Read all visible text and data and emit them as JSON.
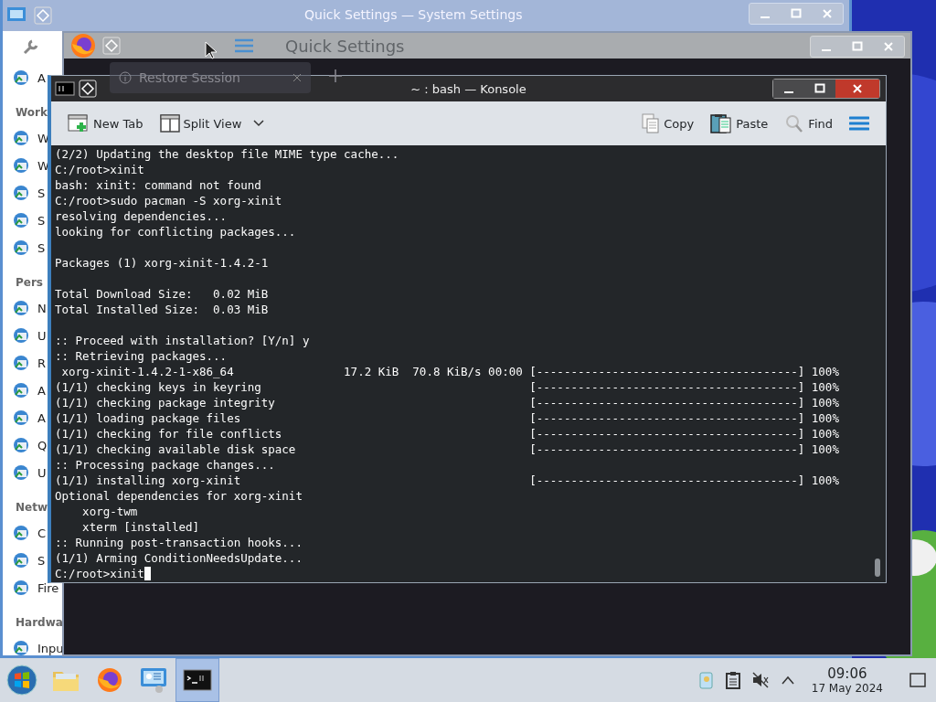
{
  "settings_window": {
    "title": "Quick Settings — System Settings",
    "sidebar": [
      {
        "kind": "item",
        "label": "A"
      },
      {
        "kind": "header",
        "label": "Work"
      },
      {
        "kind": "item",
        "label": "W"
      },
      {
        "kind": "item",
        "label": "W"
      },
      {
        "kind": "item",
        "label": "S"
      },
      {
        "kind": "item",
        "label": "S"
      },
      {
        "kind": "item",
        "label": "S"
      },
      {
        "kind": "header",
        "label": "Pers"
      },
      {
        "kind": "item",
        "label": "N"
      },
      {
        "kind": "item",
        "label": "U"
      },
      {
        "kind": "item",
        "label": "R"
      },
      {
        "kind": "item",
        "label": "A"
      },
      {
        "kind": "item",
        "label": "A"
      },
      {
        "kind": "item",
        "label": "Q"
      },
      {
        "kind": "item",
        "label": "U"
      },
      {
        "kind": "header",
        "label": "Netw"
      },
      {
        "kind": "item",
        "label": "C"
      },
      {
        "kind": "item",
        "label": "S"
      },
      {
        "kind": "item",
        "label": "Fire"
      },
      {
        "kind": "header",
        "label": "Hardwa"
      },
      {
        "kind": "item",
        "label": "Inpu"
      }
    ]
  },
  "browser_window": {
    "heading": "Quick Settings",
    "tab": {
      "label": "Restore Session"
    }
  },
  "konsole": {
    "title": "~ : bash — Konsole",
    "toolbar_left": [
      {
        "kind": "new-tab",
        "label": "New Tab"
      },
      {
        "kind": "split",
        "label": "Split View"
      }
    ],
    "toolbar_right": [
      {
        "kind": "copy",
        "label": "Copy"
      },
      {
        "kind": "paste",
        "label": "Paste"
      },
      {
        "kind": "find",
        "label": "Find"
      },
      {
        "kind": "menu"
      }
    ],
    "lines": [
      {
        "text": "(2/2) Updating the desktop file MIME type cache..."
      },
      {
        "text": "C:/root>xinit"
      },
      {
        "text": "bash: xinit: command not found"
      },
      {
        "text": "C:/root>sudo pacman -S xorg-xinit"
      },
      {
        "text": "resolving dependencies..."
      },
      {
        "text": "looking for conflicting packages..."
      },
      {
        "kind": "blank"
      },
      {
        "text": "Packages (1) xorg-xinit-1.4.2-1"
      },
      {
        "kind": "blank"
      },
      {
        "text": "Total Download Size:   0.02 MiB"
      },
      {
        "text": "Total Installed Size:  0.03 MiB"
      },
      {
        "kind": "blank"
      },
      {
        "text": ":: Proceed with installation? [Y/n] y"
      },
      {
        "text": ":: Retrieving packages..."
      },
      {
        "text": " xorg-xinit-1.4.2-1-x86_64                17.2 KiB  70.8 KiB/s 00:00",
        "progress": "[--------------------------------------] 100%"
      },
      {
        "text": "(1/1) checking keys in keyring",
        "progress": "[--------------------------------------] 100%"
      },
      {
        "text": "(1/1) checking package integrity",
        "progress": "[--------------------------------------] 100%"
      },
      {
        "text": "(1/1) loading package files",
        "progress": "[--------------------------------------] 100%"
      },
      {
        "text": "(1/1) checking for file conflicts",
        "progress": "[--------------------------------------] 100%"
      },
      {
        "text": "(1/1) checking available disk space",
        "progress": "[--------------------------------------] 100%"
      },
      {
        "text": ":: Processing package changes..."
      },
      {
        "text": "(1/1) installing xorg-xinit",
        "progress": "[--------------------------------------] 100%"
      },
      {
        "text": "Optional dependencies for xorg-xinit"
      },
      {
        "text": "    xorg-twm"
      },
      {
        "text": "    xterm [installed]"
      },
      {
        "text": ":: Running post-transaction hooks..."
      },
      {
        "text": "(1/1) Arming ConditionNeedsUpdate..."
      },
      {
        "text": "C:/root>xinit",
        "cursor": true
      }
    ]
  },
  "taskbar": {
    "apps": [
      {
        "kind": "start",
        "selected": false
      },
      {
        "kind": "files",
        "selected": false
      },
      {
        "kind": "firefox",
        "selected": false
      },
      {
        "kind": "settings",
        "selected": false
      },
      {
        "kind": "terminal",
        "selected": true
      }
    ],
    "tray": [
      {
        "kind": "notes"
      },
      {
        "kind": "clipboard"
      },
      {
        "kind": "muted"
      },
      {
        "kind": "expand"
      }
    ],
    "clock": {
      "time": "09:06",
      "date": "17 May 2024"
    }
  }
}
